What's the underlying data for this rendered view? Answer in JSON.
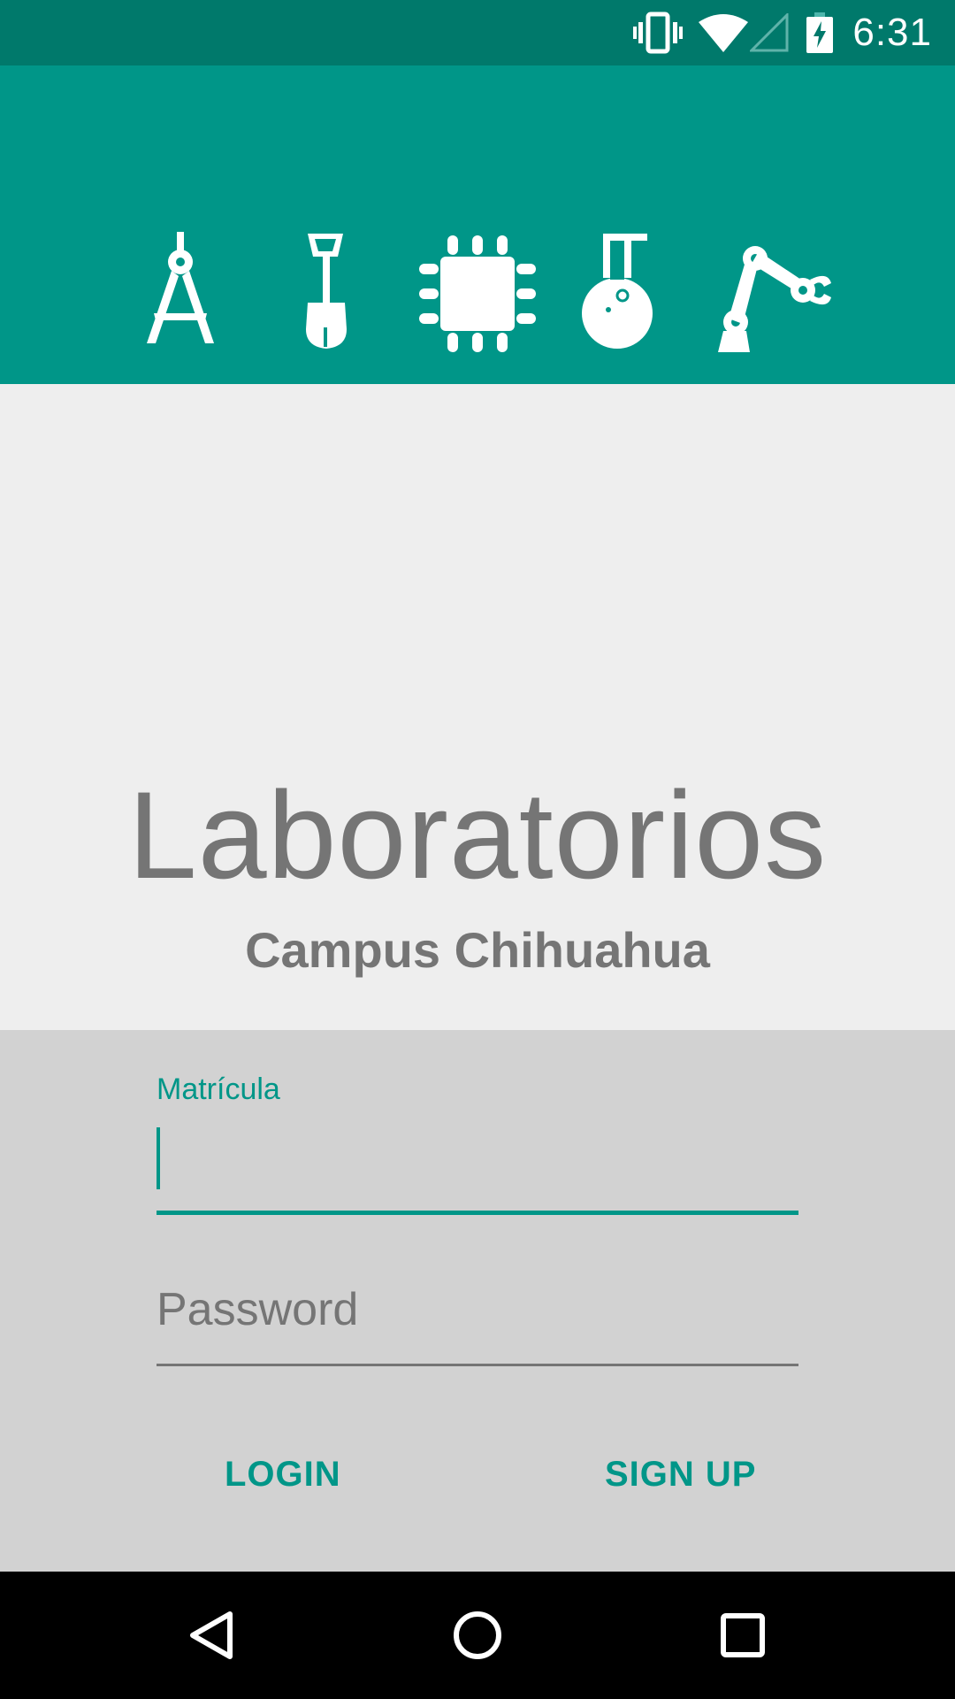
{
  "status_bar": {
    "time": "6:31",
    "icons": [
      "vibrate-icon",
      "wifi-icon",
      "cell-signal-icon",
      "battery-charging-icon"
    ],
    "background": "#00796b"
  },
  "header": {
    "background": "#009688",
    "icons": [
      "compass-icon",
      "shovel-icon",
      "chip-icon",
      "flask-icon",
      "robot-arm-icon"
    ]
  },
  "title": {
    "main": "Laboratorios",
    "subtitle": "Campus Chihuahua"
  },
  "form": {
    "matricula_label": "Matrícula",
    "matricula_value": "",
    "password_placeholder": "Password",
    "login_label": "LOGIN",
    "signup_label": "SIGN UP"
  },
  "colors": {
    "accent": "#009688",
    "text_gray": "#757575",
    "form_background": "#d2d2d2",
    "page_background": "#eeeeee"
  },
  "nav_bar": {
    "buttons": [
      "back-icon",
      "home-icon",
      "recents-icon"
    ]
  }
}
